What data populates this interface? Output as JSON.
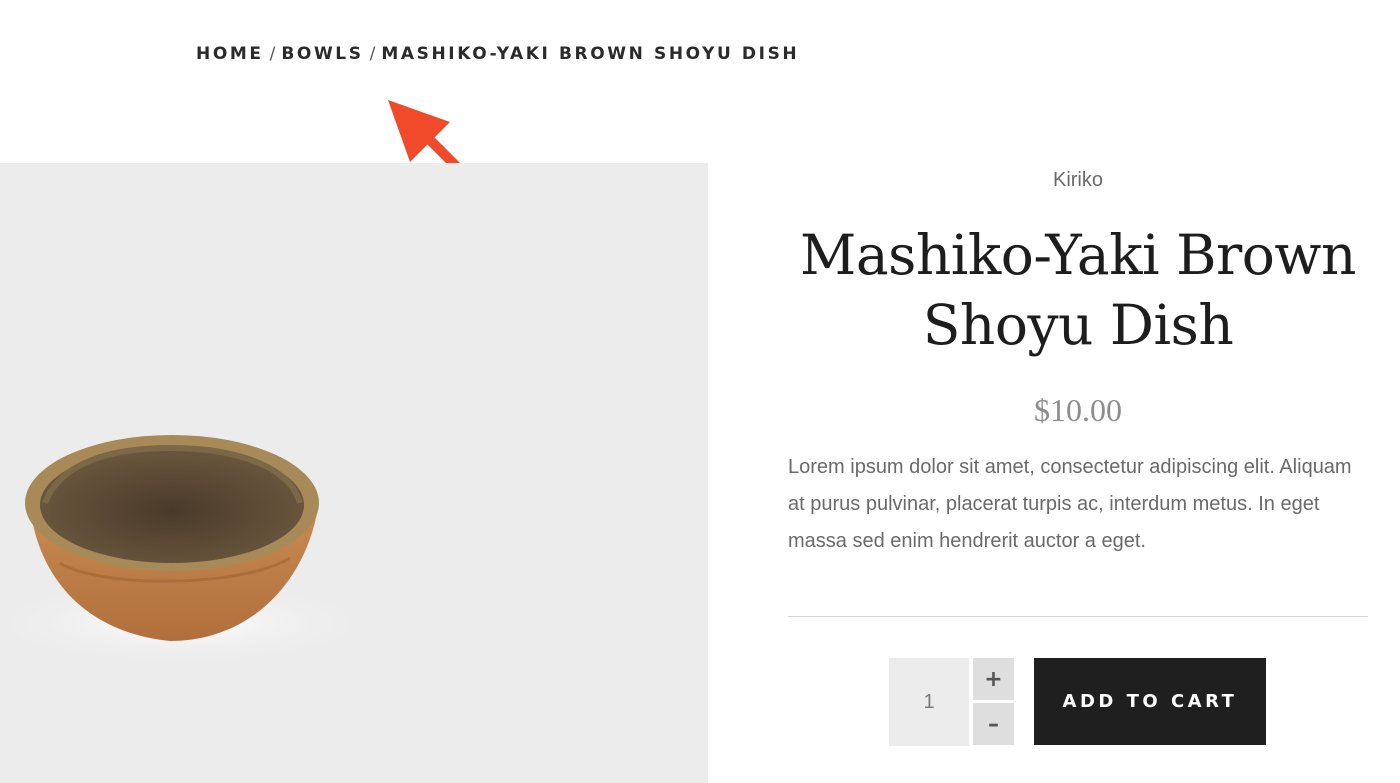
{
  "breadcrumb": {
    "items": [
      "HOME",
      "BOWLS",
      "MASHIKO-YAKI BROWN SHOYU DISH"
    ],
    "separator": "/"
  },
  "annotation": {
    "icon": "arrow-up-left-icon",
    "color": "#f04a2a"
  },
  "product": {
    "vendor": "Kiriko",
    "title_line1": "Mashiko-Yaki Brown",
    "title_line2": "Shoyu Dish",
    "price": "$10.00",
    "description": "Lorem ipsum dolor sit amet, consectetur adipiscing elit. Aliquam at purus pulvinar, placerat turpis ac, interdum metus. In eget massa sed enim hendrerit auctor a eget.",
    "image_background": "#ececec"
  },
  "cart": {
    "quantity": "1",
    "plus_label": "+",
    "minus_label": "–",
    "add_to_cart_label": "ADD TO CART",
    "button_color": "#1f1f1f"
  }
}
